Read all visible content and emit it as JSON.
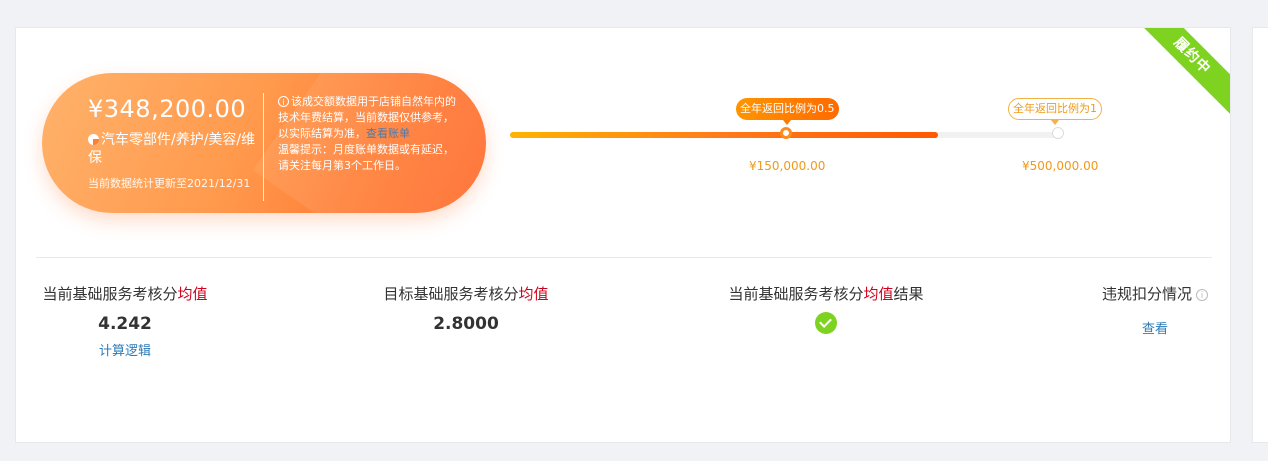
{
  "status_ribbon": "履约中",
  "summary": {
    "amount": "¥348,200.00",
    "category": "汽车零部件/养护/美容/维保",
    "update_note": "当前数据统计更新至2021/12/31",
    "note_text": "该成交额数据用于店铺自然年内的技术年费结算，当前数据仅供参考，以实际结算为准，",
    "note_link": "查看账单",
    "tip_text": "温馨提示：月度账单数据或有延迟，请关注每月第3个工作日。"
  },
  "progress": {
    "fraction": 0.775,
    "milestones": [
      {
        "tag": "全年返回比例为0.5",
        "value": "¥150,000.00",
        "reached": true
      },
      {
        "tag": "全年返回比例为1",
        "value": "¥500,000.00",
        "reached": false
      }
    ]
  },
  "stats": {
    "current": {
      "title_prefix": "当前基础服务考核分",
      "title_hl": "均值",
      "value": "4.242",
      "link": "计算逻辑"
    },
    "target": {
      "title_prefix": "目标基础服务考核分",
      "title_hl": "均值",
      "value": "2.8000"
    },
    "result": {
      "title_prefix": "当前基础服务考核分",
      "title_hl": "均值",
      "title_suffix": "结果",
      "icon": "check-icon"
    },
    "violation": {
      "title": "违规扣分情况",
      "icon": "info-icon",
      "link": "查看"
    }
  }
}
